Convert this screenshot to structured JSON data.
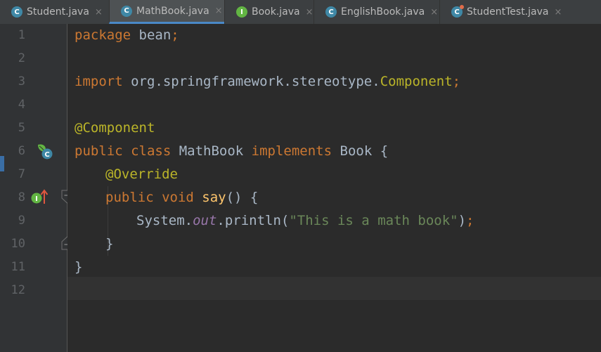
{
  "tabs": [
    {
      "label": "Student.java",
      "icon": "class-icon",
      "icon_letter": "C",
      "close": "×",
      "active": false
    },
    {
      "label": "MathBook.java",
      "icon": "class-icon",
      "icon_letter": "C",
      "close": "×",
      "active": true
    },
    {
      "label": "Book.java",
      "icon": "interface-icon",
      "icon_letter": "I",
      "close": "×",
      "active": false
    },
    {
      "label": "EnglishBook.java",
      "icon": "class-icon",
      "icon_letter": "C",
      "close": "×",
      "active": false
    },
    {
      "label": "StudentTest.java",
      "icon": "runnable-class-icon",
      "icon_letter": "C",
      "close": "×",
      "active": false
    }
  ],
  "line_numbers": [
    "1",
    "2",
    "3",
    "4",
    "5",
    "6",
    "7",
    "8",
    "9",
    "10",
    "11",
    "12"
  ],
  "code": {
    "l1": {
      "kw": "package",
      "rest": " bean",
      "semi": ";"
    },
    "l3": {
      "kw": "import",
      "pkg": " org.springframework.stereotype.",
      "cls": "Component",
      "semi": ";"
    },
    "l5": {
      "ann": "@Component"
    },
    "l6": {
      "kw1": "public",
      "kw2": " class",
      "name": " MathBook",
      "kw3": " implements",
      "iface": " Book",
      "brace": " {"
    },
    "l7": {
      "ann": "@Override"
    },
    "l8": {
      "kw1": "public",
      "kw2": " void",
      "method": " say",
      "rest": "() {"
    },
    "l9": {
      "obj": "System.",
      "field": "out",
      "call": ".println(",
      "str": "\"This is a math book\"",
      "close": ")",
      "semi": ";"
    },
    "l10": {
      "brace": "}"
    },
    "l11": {
      "brace": "}"
    }
  },
  "colors": {
    "keyword": "#cc7832",
    "annotation": "#bbb529",
    "string": "#6a8759",
    "field": "#9876aa",
    "method": "#ffc66d",
    "text": "#a9b7c6",
    "background": "#2b2b2b",
    "gutter": "#313335",
    "tab_accent": "#4a88c7"
  }
}
